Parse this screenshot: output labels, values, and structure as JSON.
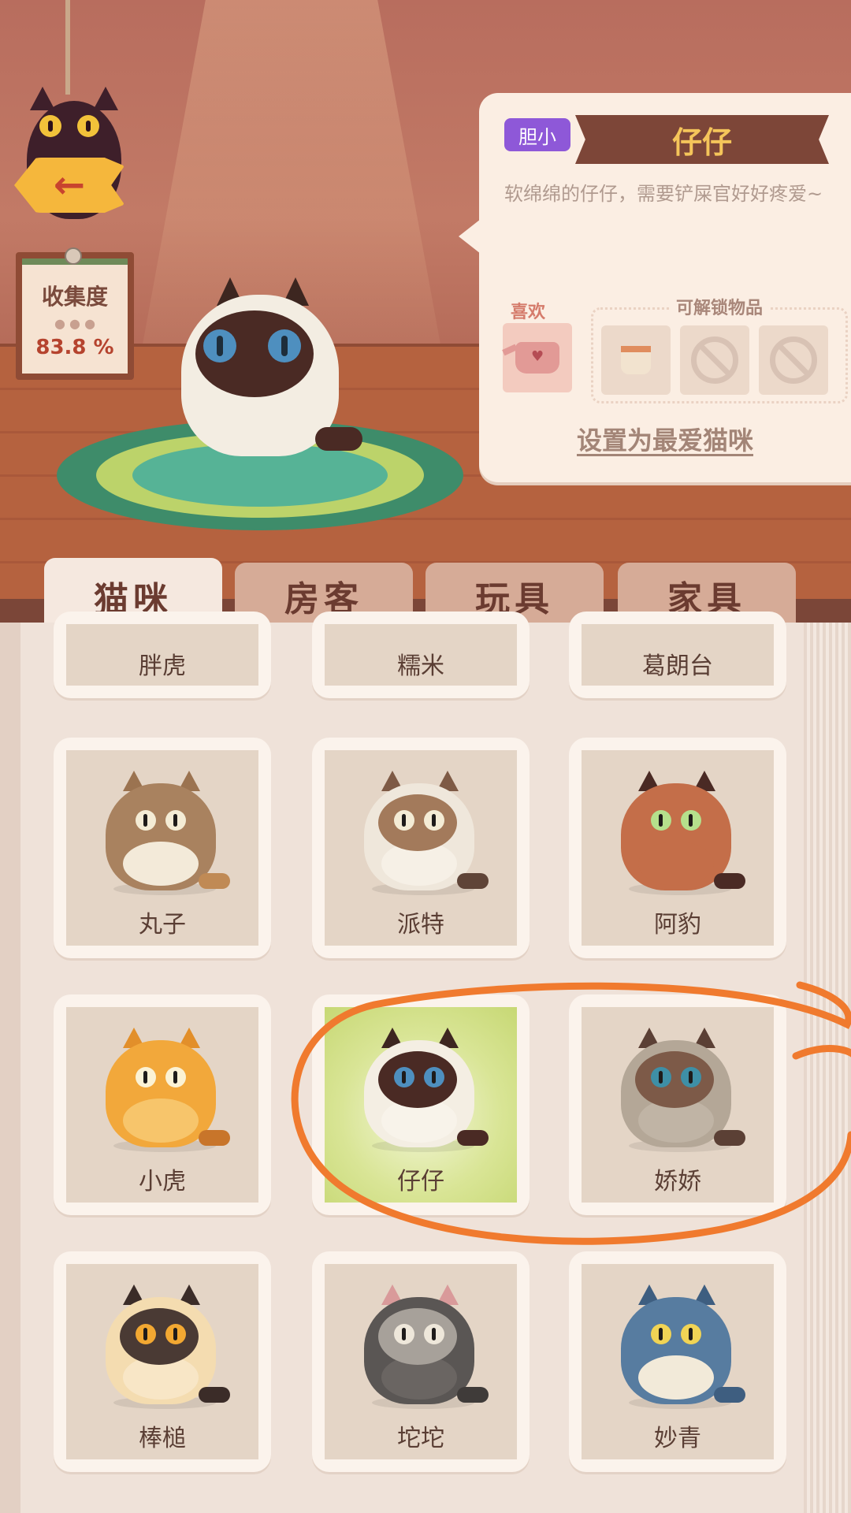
{
  "collection": {
    "label": "收集度",
    "value": "83.8 %"
  },
  "selected_cat": {
    "trait_badge": "胆小",
    "name": "仔仔",
    "description": "软绵绵的仔仔，需要铲屎官好好疼爱~",
    "likes_label": "喜欢",
    "unlockables_label": "可解锁物品",
    "set_favorite_label": "设置为最爱猫咪"
  },
  "tabs": [
    {
      "label": "猫咪",
      "active": true
    },
    {
      "label": "房客",
      "active": false
    },
    {
      "label": "玩具",
      "active": false
    },
    {
      "label": "家具",
      "active": false
    }
  ],
  "cats": [
    {
      "name": "胖虎"
    },
    {
      "name": "糯米"
    },
    {
      "name": "葛朗台"
    },
    {
      "name": "丸子",
      "body": "#a9825f",
      "belly": "#f3ead9",
      "eyes": "#f4ecd5",
      "ears": "#9b7350",
      "tail": "#c08a55"
    },
    {
      "name": "派特",
      "body": "#efe7db",
      "belly": "#f6f0e6",
      "face": "#a37a5b",
      "eyes": "#f4ecd5",
      "ears": "#7e5a45",
      "tail": "#5f4437"
    },
    {
      "name": "阿豹",
      "body": "#c46e49",
      "belly": "#c46e49",
      "eyes": "#b5e08c",
      "ears": "#4a2a24",
      "tail": "#4a2a24"
    },
    {
      "name": "小虎",
      "body": "#f2a83b",
      "belly": "#f7c56b",
      "eyes": "#fbf2d5",
      "ears": "#e28f2a",
      "tail": "#c8752a"
    },
    {
      "name": "仔仔",
      "body": "#f4eee3",
      "belly": "#f8f3ea",
      "face": "#4a2a24",
      "eyes": "#4e8fbf",
      "ears": "#3d2620",
      "tail": "#4a2a24",
      "selected": true
    },
    {
      "name": "娇娇",
      "body": "#b4a797",
      "belly": "#c0b4a5",
      "face": "#7d5a48",
      "eyes": "#3e8fa6",
      "ears": "#5b4035",
      "tail": "#5b4035"
    },
    {
      "name": "棒槌",
      "body": "#f4dcb0",
      "belly": "#f8e6c6",
      "face": "#4a3a34",
      "eyes": "#f2a832",
      "ears": "#3b2c28",
      "tail": "#3b2c28"
    },
    {
      "name": "坨坨",
      "body": "#5a5654",
      "belly": "#6a6562",
      "face": "#a7a19a",
      "eyes": "#eee7da",
      "ears": "#d99a9a",
      "tail": "#3f3b39"
    },
    {
      "name": "妙青",
      "body": "#577ca0",
      "belly": "#f2ead9",
      "eyes": "#f1d455",
      "ears": "#3e5e80",
      "tail": "#3e5e80"
    }
  ],
  "colors": {
    "accent_purple": "#8e58d8",
    "ribbon": "#7d4638",
    "title_gold": "#f5c55a",
    "annotation": "#f07a2e"
  }
}
